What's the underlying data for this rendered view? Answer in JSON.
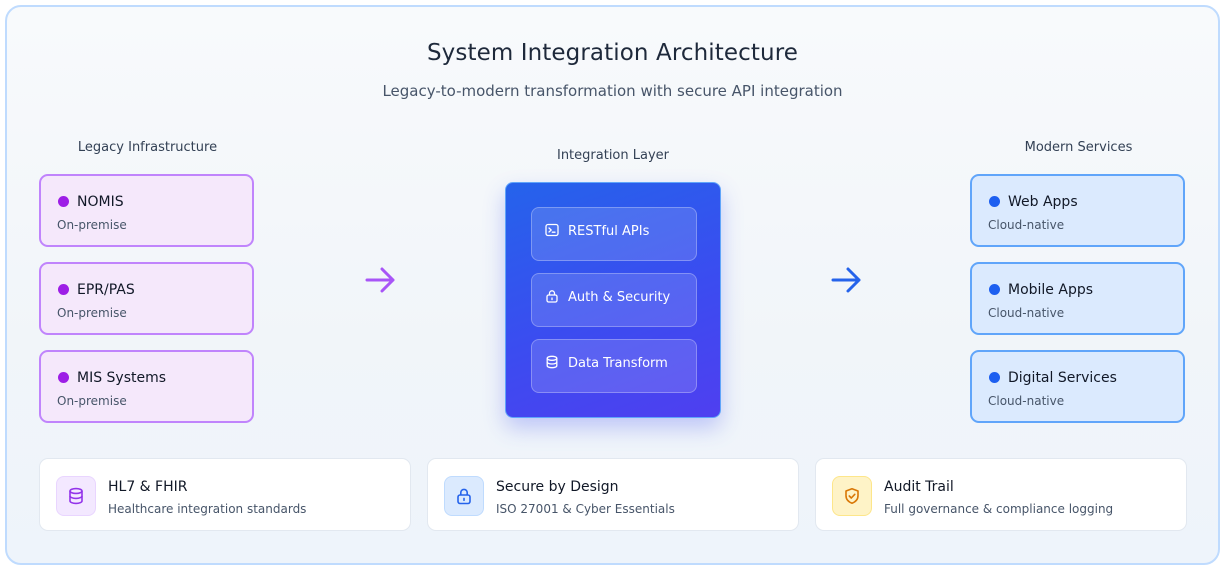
{
  "header": {
    "title": "System Integration Architecture",
    "subtitle": "Legacy-to-modern transformation with secure API integration"
  },
  "legacy": {
    "heading": "Legacy Infrastructure",
    "items": [
      {
        "label": "NOMIS",
        "sub": "On-premise"
      },
      {
        "label": "EPR/PAS",
        "sub": "On-premise"
      },
      {
        "label": "MIS Systems",
        "sub": "On-premise"
      }
    ]
  },
  "integration": {
    "heading": "Integration Layer",
    "items": [
      {
        "label": "RESTful APIs",
        "icon": "terminal-icon"
      },
      {
        "label": "Auth & Security",
        "icon": "lock-icon"
      },
      {
        "label": "Data Transform",
        "icon": "database-icon"
      }
    ]
  },
  "modern": {
    "heading": "Modern Services",
    "items": [
      {
        "label": "Web Apps",
        "sub": "Cloud-native"
      },
      {
        "label": "Mobile Apps",
        "sub": "Cloud-native"
      },
      {
        "label": "Digital Services",
        "sub": "Cloud-native"
      }
    ]
  },
  "features": [
    {
      "title": "HL7 & FHIR",
      "sub": "Healthcare integration standards",
      "icon": "database-icon"
    },
    {
      "title": "Secure by Design",
      "sub": "ISO 27001 & Cyber Essentials",
      "icon": "lock-icon"
    },
    {
      "title": "Audit Trail",
      "sub": "Full governance & compliance logging",
      "icon": "shield-check-icon"
    }
  ],
  "colors": {
    "legacy_accent": "#9d1ee6",
    "modern_accent": "#1d5ff0",
    "integration_bg": "#3b4cf0",
    "legacy_arrow": "#a855f7",
    "modern_arrow": "#2563eb"
  }
}
